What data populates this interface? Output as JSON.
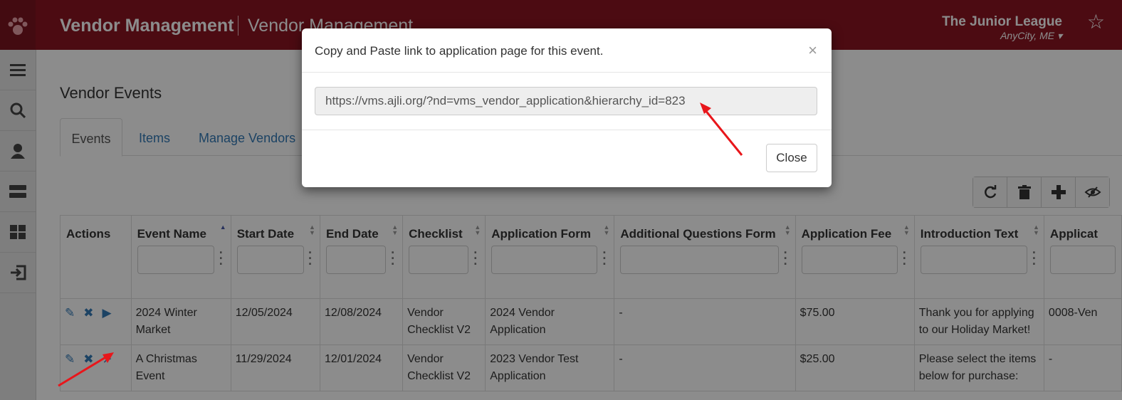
{
  "header": {
    "brand": "Vendor Management",
    "brand_sub": "Vendor Management",
    "org_name": "The Junior League",
    "org_location": "AnyCity, ME",
    "bg_color": "#8b1522",
    "icons": [
      "paw-icon",
      "star-icon"
    ]
  },
  "sidebar": {
    "icons": [
      "menu-icon",
      "search-icon",
      "user-icon",
      "server-icon",
      "grid-icon",
      "logout-icon"
    ]
  },
  "page": {
    "title": "Vendor Events",
    "tabs": [
      "Events",
      "Items",
      "Manage Vendors"
    ],
    "active_tab": "Events"
  },
  "toolbar": {
    "icons": [
      "refresh-icon",
      "trash-icon",
      "plus-icon",
      "hide-icon"
    ]
  },
  "table": {
    "columns": [
      "Actions",
      "Event Name",
      "Start Date",
      "End Date",
      "Checklist",
      "Application Form",
      "Additional Questions Form",
      "Application Fee",
      "Introduction Text",
      "Applicat"
    ],
    "rows": [
      {
        "event_name": "2024 Winter Market",
        "start_date": "12/05/2024",
        "end_date": "12/08/2024",
        "checklist": "Vendor Checklist V2",
        "application_form": "2024 Vendor Application",
        "additional_form": "-",
        "fee": "$75.00",
        "intro": "Thank you for applying to our Holiday Market!",
        "applicat": "0008-Ven"
      },
      {
        "event_name": "A Christmas Event",
        "start_date": "11/29/2024",
        "end_date": "12/01/2024",
        "checklist": "Vendor Checklist V2",
        "application_form": "2023 Vendor Test Application",
        "additional_form": "-",
        "fee": "$25.00",
        "intro": "Please select the items below for purchase:",
        "applicat": "-"
      }
    ]
  },
  "modal": {
    "title": "Copy and Paste link to application page for this event.",
    "close_symbol": "×",
    "link_value": "https://vms.ajli.org/?nd=vms_vendor_application&hierarchy_id=823",
    "close_label": "Close"
  },
  "annotation_color": "#e8161b"
}
